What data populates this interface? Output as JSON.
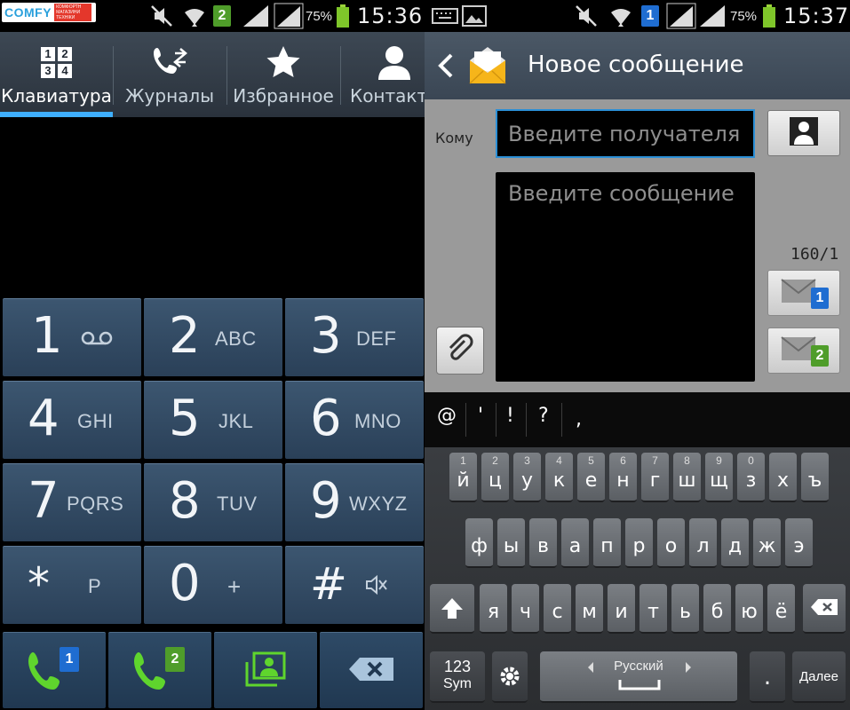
{
  "left_screen": {
    "status": {
      "brand": "COMFY",
      "brand_tag": "КОМФОРТН МАГАЗИНИ ТЕХНІКИ",
      "sim_slot": "2",
      "battery_percent": "75%",
      "time": "15:36"
    },
    "tabs": [
      {
        "label": "Клавиатура",
        "icon": "keypad-icon",
        "active": true
      },
      {
        "label": "Журналы",
        "icon": "call-log-icon",
        "active": false
      },
      {
        "label": "Избранное",
        "icon": "star-icon",
        "active": false
      },
      {
        "label": "Контакт",
        "icon": "person-icon",
        "active": false
      }
    ],
    "keypad_digits": [
      "1",
      "2",
      "3",
      "4",
      "5",
      "6",
      "7",
      "8",
      "9",
      "0"
    ],
    "keypad_letters": {
      "k1": "",
      "k2": "ABC",
      "k3": "DEF",
      "k4": "GHI",
      "k5": "JKL",
      "k6": "MNO",
      "k7": "PQRS",
      "k8": "TUV",
      "k9": "WXYZ",
      "k0": "+",
      "kstar_main": "*",
      "kstar_sub": "P",
      "khash_main": "#"
    },
    "call_buttons": {
      "sim1": "1",
      "sim2": "2"
    },
    "colors": {
      "key_bg": "#33506b",
      "tab_accent": "#3fb0ff",
      "call_green": "#5fd52d"
    }
  },
  "right_screen": {
    "status": {
      "sim_slot": "1",
      "battery_percent": "75%",
      "time": "15:37"
    },
    "header_title": "Новое сообщение",
    "to_label": "Кому",
    "recipient_placeholder": "Введите получателя",
    "message_placeholder": "Введите сообщение",
    "char_counter": "160/1",
    "send_sim1": "1",
    "send_sim2": "2",
    "symbols": [
      "@",
      "'",
      "!",
      "?",
      ","
    ],
    "row1": [
      {
        "main": "й",
        "alt": "1"
      },
      {
        "main": "ц",
        "alt": "2"
      },
      {
        "main": "у",
        "alt": "3"
      },
      {
        "main": "к",
        "alt": "4"
      },
      {
        "main": "е",
        "alt": "5"
      },
      {
        "main": "н",
        "alt": "6"
      },
      {
        "main": "г",
        "alt": "7"
      },
      {
        "main": "ш",
        "alt": "8"
      },
      {
        "main": "щ",
        "alt": "9"
      },
      {
        "main": "з",
        "alt": "0"
      },
      {
        "main": "х",
        "alt": ""
      },
      {
        "main": "ъ",
        "alt": ""
      }
    ],
    "row2": [
      "ф",
      "ы",
      "в",
      "а",
      "п",
      "р",
      "о",
      "л",
      "д",
      "ж",
      "э"
    ],
    "row3": [
      "я",
      "ч",
      "с",
      "м",
      "и",
      "т",
      "ь",
      "б",
      "ю",
      "ё"
    ],
    "bottom": {
      "sym_key_top": "123",
      "sym_key_bottom": "Sym",
      "language": "Русский",
      "period": ".",
      "done": "Далее"
    }
  }
}
